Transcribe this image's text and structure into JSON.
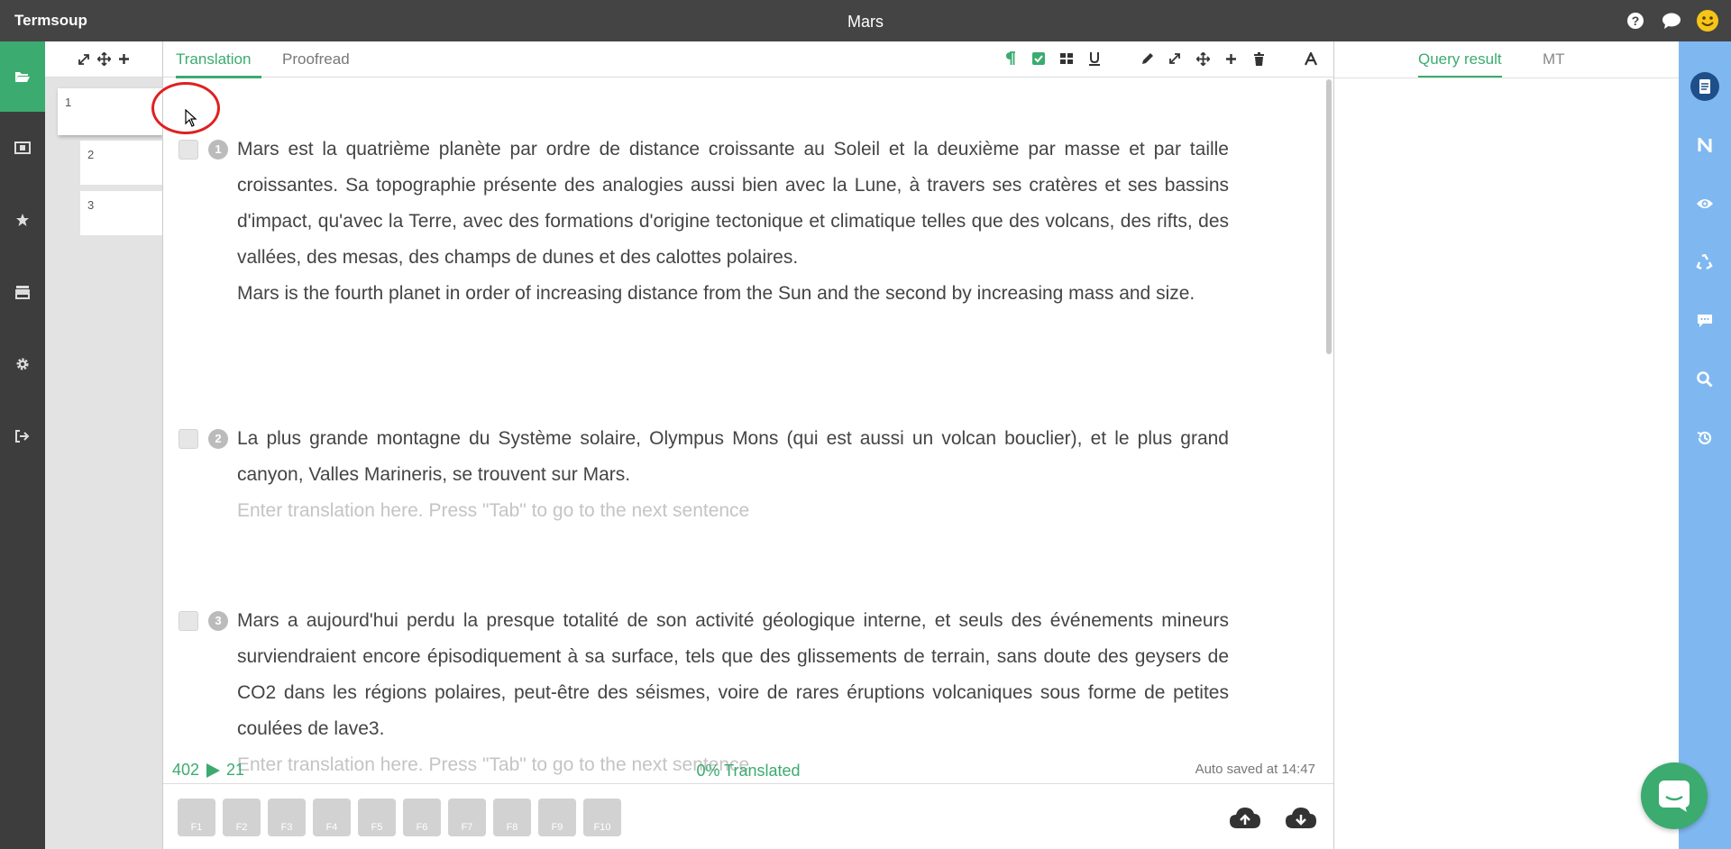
{
  "app": {
    "name": "Termsoup",
    "document_title": "Mars"
  },
  "colors": {
    "accent": "#3bab6f",
    "topbar": "#444444",
    "leftnav": "#3d3d3d",
    "rightbar": "#7fb8f0",
    "highlight_ring": "#e02020"
  },
  "top_icons": [
    "help-icon",
    "chat-icon",
    "smiley-icon"
  ],
  "left_nav": [
    "folder-open-icon",
    "film-icon",
    "star-icon",
    "store-icon",
    "gear-icon",
    "sign-out-icon"
  ],
  "segment_panel": {
    "tools": [
      "compress-icon",
      "move-icon",
      "plus-icon"
    ],
    "thumbnails": [
      "1",
      "2",
      "3"
    ]
  },
  "editor": {
    "tabs": [
      {
        "label": "Translation",
        "active": true
      },
      {
        "label": "Proofread",
        "active": false
      }
    ],
    "toolbar": [
      "paragraph-icon",
      "check-square-icon",
      "grid-icon",
      "underline-icon",
      "pencil-icon",
      "compress-icon",
      "move-icon",
      "plus-icon",
      "trash-icon",
      "font-icon"
    ],
    "segments": [
      {
        "num": "1",
        "source": "Mars est la quatrième planète par ordre de distance croissante au Soleil et la deuxième par masse et par taille croissantes. Sa topographie présente des analogies aussi bien avec la Lune, à travers ses cratères et ses bassins d'impact, qu'avec la Terre, avec des formations d'origine tectonique et climatique telles que des volcans, des rifts, des vallées, des mesas, des champs de dunes et des calottes polaires.",
        "translation": "Mars is the fourth planet in order of increasing distance from the Sun and the second by increasing mass and size."
      },
      {
        "num": "2",
        "source": "La plus grande montagne du Système solaire, Olympus Mons (qui est aussi un volcan bouclier), et le plus grand canyon, Valles Marineris, se trouvent sur Mars.",
        "placeholder": "Enter translation here. Press \"Tab\" to go to the next sentence"
      },
      {
        "num": "3",
        "source": "Mars a aujourd'hui perdu la presque totalité de son activité géologique interne, et seuls des événements mineurs surviendraient encore épisodiquement à sa surface, tels que des glissements de terrain, sans doute des geysers de CO2 dans les régions polaires, peut-être des séismes, voire de rares éruptions volcaniques sous forme de petites coulées de lave3.",
        "placeholder": "Enter translation here. Press \"Tab\" to go to the next sentence"
      }
    ],
    "status": {
      "source_words": "402",
      "target_words": "21",
      "progress_label": "0% Translated",
      "autosave": "Auto saved at 14:47"
    },
    "function_keys": [
      "F1",
      "F2",
      "F3",
      "F4",
      "F5",
      "F6",
      "F7",
      "F8",
      "F9",
      "F10"
    ],
    "cloud_actions": [
      "cloud-upload-icon",
      "cloud-download-icon"
    ]
  },
  "right_panel": {
    "tabs": [
      {
        "label": "Query result",
        "active": true
      },
      {
        "label": "MT",
        "active": false
      }
    ]
  },
  "right_bar": [
    "notes-icon",
    "n-icon",
    "eye-icon",
    "recycle-icon",
    "comment-icon",
    "search-icon",
    "history-icon"
  ]
}
